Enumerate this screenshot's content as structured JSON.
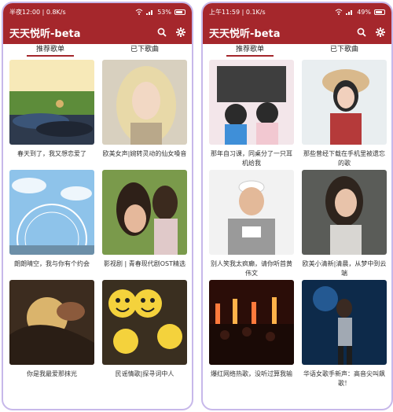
{
  "left": {
    "status": {
      "time": "半夜12:00 | 0.8K/s",
      "battery": "53%"
    },
    "app_title": "天天悦听-beta",
    "tabs": [
      "推荐歌单",
      "已下歌曲"
    ],
    "cards": [
      {
        "caption": "春天到了，我又想恋爱了"
      },
      {
        "caption": "欧美女声|婉转灵动的仙女嗓音"
      },
      {
        "caption": "朗朗晴空，我与你有个约会"
      },
      {
        "caption": "影视剧 | 青春现代剧OST精选"
      },
      {
        "caption": "你是我最爱那抹光"
      },
      {
        "caption": "民谣情歌|探寻词中人"
      }
    ]
  },
  "right": {
    "status": {
      "time": "上午11:59 | 0.1K/s",
      "battery": "49%"
    },
    "app_title": "天天悦听-beta",
    "tabs": [
      "推荐歌单",
      "已下歌曲"
    ],
    "cards": [
      {
        "caption": "那年自习课，同桌分了一只耳机给我"
      },
      {
        "caption": "那些曾经下载在手机里被遗忘的歌"
      },
      {
        "caption": "别人笑我太疯癫，请你听首黄伟文"
      },
      {
        "caption": "欧美小清新|清晨，从梦中到云端"
      },
      {
        "caption": "爆红网络热歌，没听过算我输"
      },
      {
        "caption": "华语女歌手新声：高音尖叫飙歌！"
      }
    ]
  },
  "icons": {
    "search": "search-icon",
    "settings": "gear-icon"
  },
  "colors": {
    "brand": "#a5272c",
    "frame": "#c7b8ea"
  }
}
